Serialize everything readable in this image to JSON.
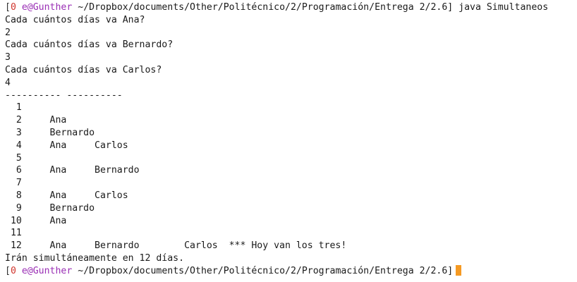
{
  "colors": {
    "background": "#ffffff",
    "text": "#1a1a1a",
    "prompt_status": "#d0342c",
    "prompt_user": "#9a2fb5",
    "cursor": "#f59a23"
  },
  "prompt": {
    "open_bracket": "[",
    "status": "0",
    "user": "e@Gunther",
    "path": " ~/Dropbox/documents/Other/Politécnico/2/Programación/Entrega 2/2.6]"
  },
  "command": " java Simultaneos",
  "output": [
    "Cada cuántos días va Ana?",
    "2",
    "Cada cuántos días va Bernardo?",
    "3",
    "Cada cuántos días va Carlos?",
    "4",
    "---------- ----------",
    "  1",
    "  2     Ana",
    "  3     Bernardo",
    "  4     Ana     Carlos",
    "  5",
    "  6     Ana     Bernardo",
    "  7",
    "  8     Ana     Carlos",
    "  9     Bernardo",
    " 10     Ana",
    " 11",
    " 12     Ana     Bernardo        Carlos  *** Hoy van los tres!",
    "Irán simultáneamente en 12 días."
  ]
}
